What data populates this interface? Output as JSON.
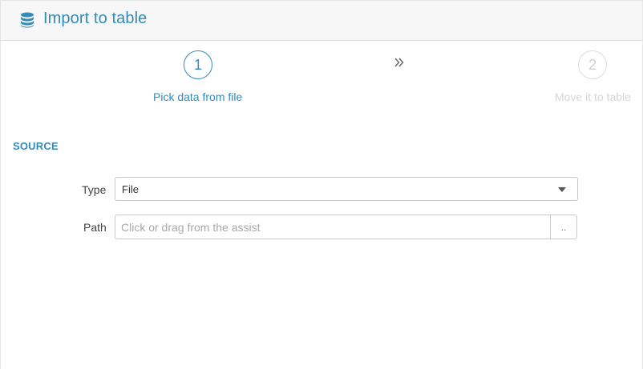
{
  "header": {
    "title": "Import to table",
    "icon": "database-icon"
  },
  "wizard": {
    "steps": [
      {
        "number": "1",
        "label": "Pick data from file",
        "state": "active"
      },
      {
        "number": "2",
        "label": "Move it to table",
        "state": "inactive"
      }
    ],
    "separator_icon": "double-chevron-right-icon"
  },
  "source": {
    "section_title": "SOURCE",
    "type": {
      "label": "Type",
      "selected": "File"
    },
    "path": {
      "label": "Path",
      "value": "",
      "placeholder": "Click or drag from the assist",
      "browse_label": ".."
    }
  },
  "colors": {
    "accent": "#338bb8",
    "inactive": "#d0d0d0",
    "header_bg": "#f7f7f7"
  }
}
